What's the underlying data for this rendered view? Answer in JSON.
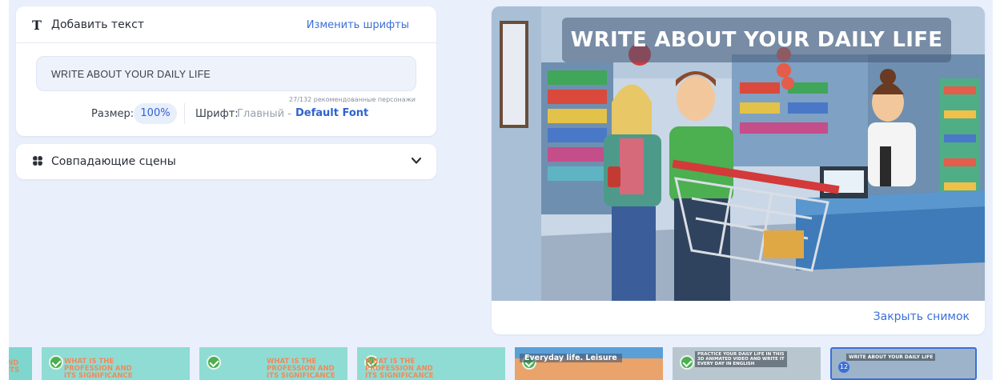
{
  "text_panel": {
    "icon": "text-t-icon",
    "title": "Добавить текст",
    "change_fonts": "Изменить шрифты",
    "input_value": "WRITE ABOUT YOUR DAILY LIFE",
    "counter": "27/132 рекомендованные персонажи",
    "size_label": "Размер:",
    "size_value": "100%",
    "font_label": "Шрифт:",
    "font_main": "Главный -",
    "font_name": "Default Font"
  },
  "scenes_panel": {
    "icon": "brain-icon",
    "title": "Совпадающие сцены",
    "toggle_icon": "chevron-down-icon"
  },
  "preview": {
    "banner": "WRITE ABOUT YOUR DAILY LIFE",
    "close_label": "Закрыть снимок"
  },
  "timeline": {
    "thumbs": [
      {
        "text": "WHAT IS THE\nPROFESSION AND\nITS SIGNIFICANCE"
      },
      {
        "text": "WHAT IS THE\nPROFESSION AND\nITS SIGNIFICANCE"
      },
      {
        "text": "WHAT IS THE\nPROFESSION AND\nITS SIGNIFICANCE"
      },
      {
        "text": "Everyday life. Leisure"
      },
      {
        "text": "PRACTICE YOUR DAILY LIFE IN THIS\n3D ANIMATED VIDEO AND WRITE IT\nEVERY DAY IN ENGLISH"
      },
      {
        "text": "WRITE ABOUT YOUR DAILY LIFE",
        "badge": "12"
      }
    ]
  },
  "colors": {
    "accent": "#3b6fd8",
    "app_bg": "#eaf0fb",
    "check_green": "#4caf50",
    "thumb_text": "#f08a5a"
  }
}
